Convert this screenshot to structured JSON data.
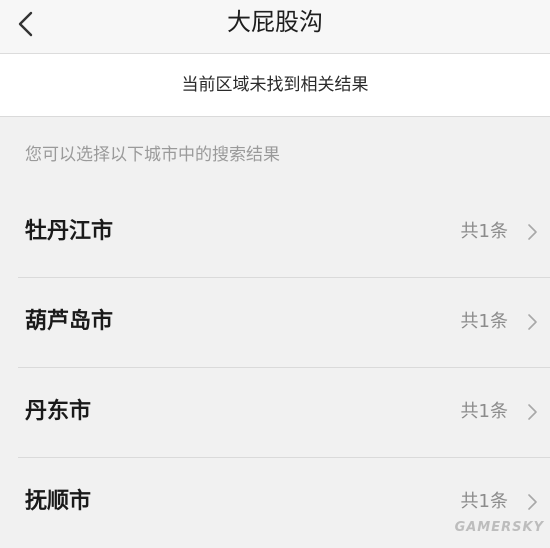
{
  "navbar": {
    "title": "大屁股沟",
    "back_icon": "chevron-left-icon"
  },
  "notice": {
    "text": "当前区域未找到相关结果"
  },
  "hint": {
    "text": "您可以选择以下城市中的搜索结果"
  },
  "cities": [
    {
      "name": "牡丹江市",
      "count": "共1条"
    },
    {
      "name": "葫芦岛市",
      "count": "共1条"
    },
    {
      "name": "丹东市",
      "count": "共1条"
    },
    {
      "name": "抚顺市",
      "count": "共1条"
    }
  ],
  "watermark": "GAMERSKY"
}
